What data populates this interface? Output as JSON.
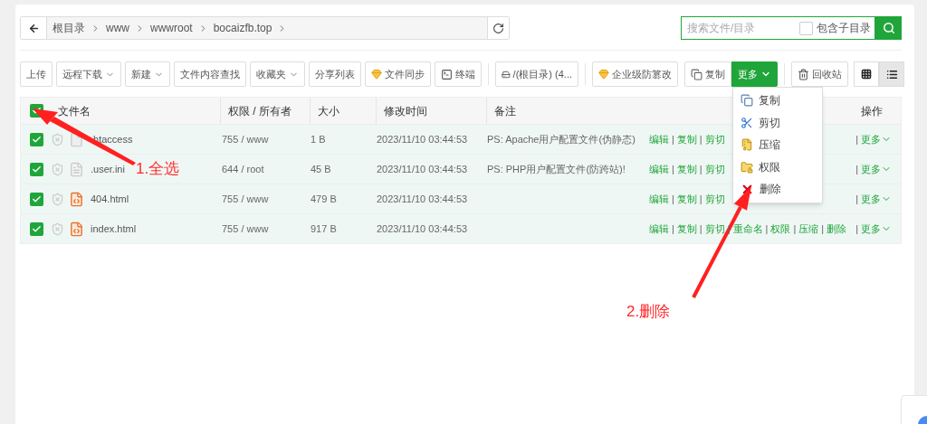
{
  "breadcrumb": {
    "segments": [
      "根目录",
      "www",
      "wwwroot",
      "bocaizfb.top"
    ]
  },
  "search": {
    "placeholder": "搜索文件/目录",
    "include_subdirs": {
      "label": "包含子目录",
      "checked": false
    }
  },
  "toolbar": [
    {
      "kind": "plain",
      "label": "上传"
    },
    {
      "kind": "dropdown",
      "label": "远程下载"
    },
    {
      "kind": "dropdown",
      "label": "新建"
    },
    {
      "kind": "plain",
      "label": "文件内容查找"
    },
    {
      "kind": "dropdown",
      "label": "收藏夹"
    },
    {
      "kind": "plain",
      "label": "分享列表"
    },
    {
      "kind": "gem",
      "label": "文件同步"
    },
    {
      "kind": "terminal",
      "label": "终端"
    },
    {
      "kind": "disk",
      "label": "/(根目录) (4..."
    },
    {
      "kind": "gem",
      "label": "企业级防篡改"
    },
    {
      "kind": "copy",
      "label": "复制"
    },
    {
      "kind": "more",
      "label": "更多"
    },
    {
      "kind": "trash",
      "label": "回收站"
    }
  ],
  "view_toggle": [
    {
      "kind": "grid",
      "selected": false
    },
    {
      "kind": "list",
      "selected": true
    }
  ],
  "more_menu": [
    {
      "kind": "copy",
      "label": "复制"
    },
    {
      "kind": "cut",
      "label": "剪切"
    },
    {
      "kind": "compress",
      "label": "压缩"
    },
    {
      "kind": "permission",
      "label": "权限"
    },
    {
      "kind": "delete",
      "label": "删除"
    }
  ],
  "table": {
    "select_all": {
      "checked": true
    },
    "columns": [
      "文件名",
      "权限 / 所有者",
      "大小",
      "修改时间",
      "备注",
      "操作"
    ],
    "separator": "|",
    "rows": [
      {
        "checked": true,
        "kind": "blank",
        "name": ".htaccess",
        "perm": "755 / www",
        "size": "1 B",
        "mtime": "2023/11/10 03:44:53",
        "note": "PS: Apache用户配置文件(伪静态)",
        "actions": [
          "编辑",
          "复制",
          "剪切"
        ],
        "more": "更多"
      },
      {
        "checked": true,
        "kind": "text",
        "name": ".user.ini",
        "perm": "644 / root",
        "size": "45 B",
        "mtime": "2023/11/10 03:44:53",
        "note": "PS: PHP用户配置文件(防跨站)!",
        "actions": [
          "编辑",
          "复制",
          "剪切"
        ],
        "more": "更多"
      },
      {
        "checked": true,
        "kind": "html",
        "name": "404.html",
        "perm": "755 / www",
        "size": "479 B",
        "mtime": "2023/11/10 03:44:53",
        "actions": [
          "编辑",
          "复制",
          "剪切"
        ],
        "more": "更多"
      },
      {
        "checked": true,
        "kind": "html",
        "name": "index.html",
        "perm": "755 / www",
        "size": "917 B",
        "mtime": "2023/11/10 03:44:53",
        "actions": [
          "编辑",
          "复制",
          "剪切",
          "重命名",
          "权限",
          "压缩",
          "删除"
        ],
        "more": "更多"
      }
    ]
  },
  "annotations": [
    "1.全选",
    "2.删除"
  ]
}
